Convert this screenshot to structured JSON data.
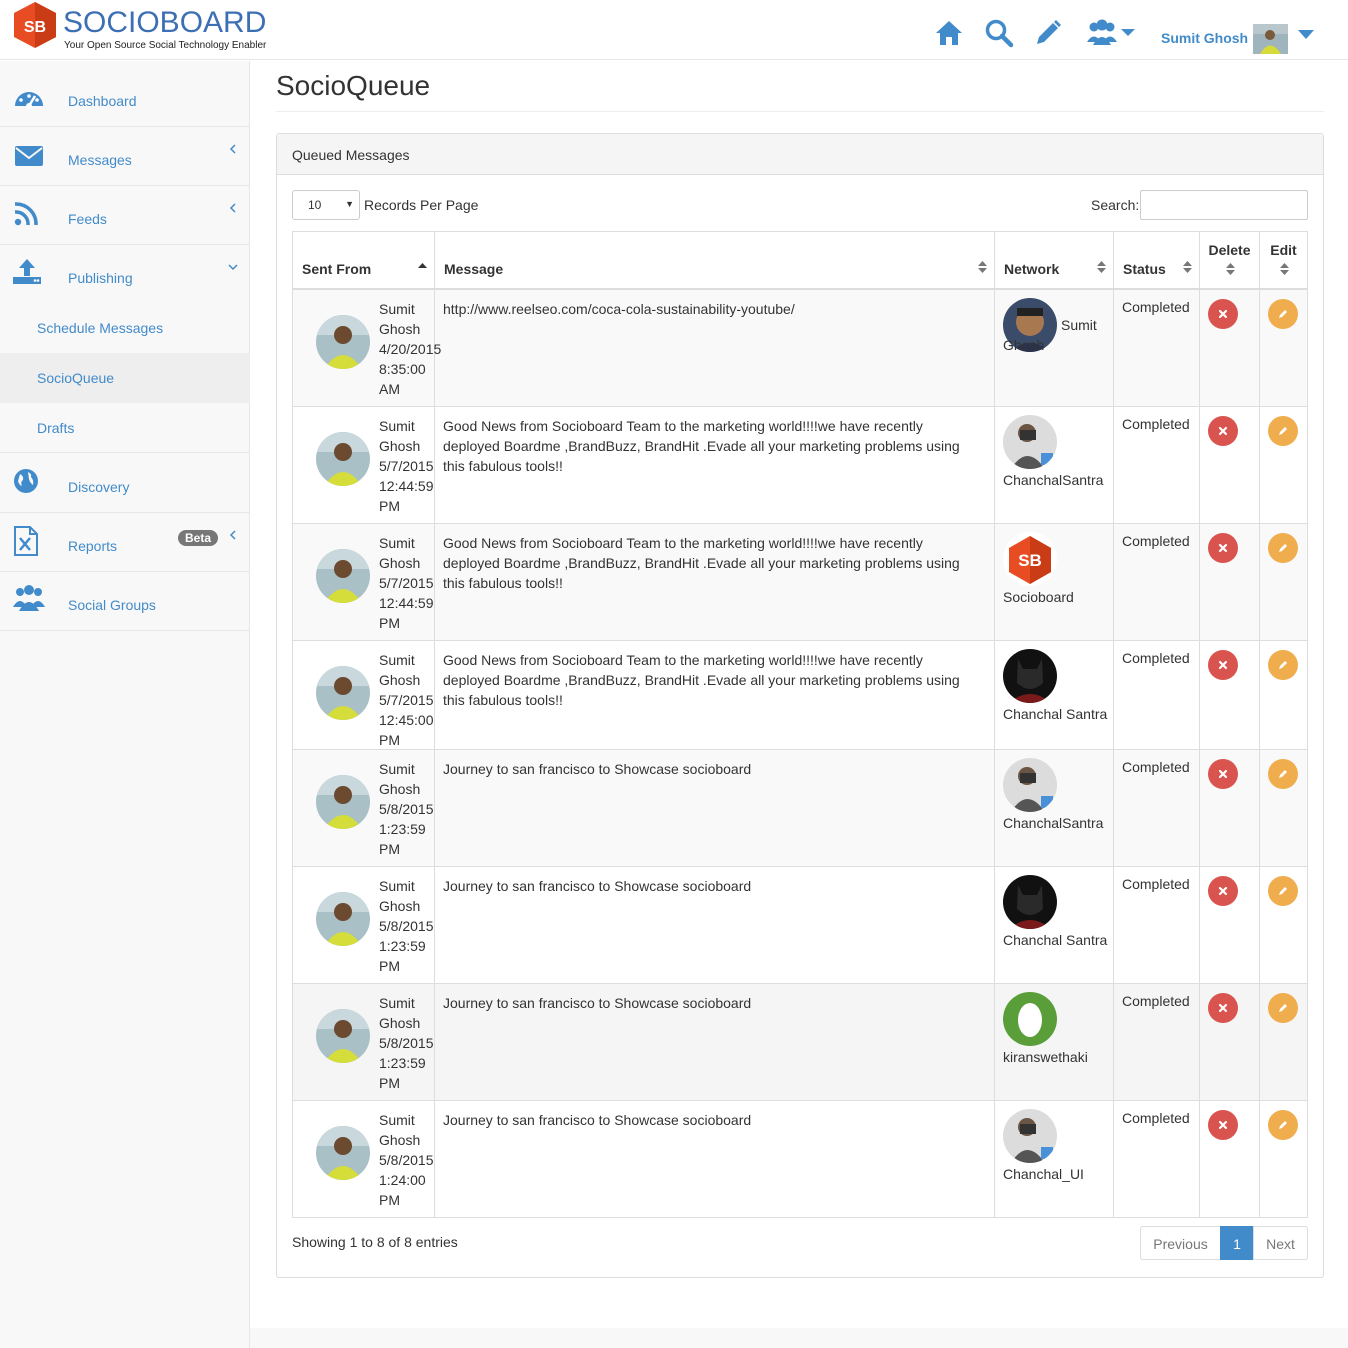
{
  "brand": {
    "badge": "SB",
    "name": "SOCIOBOARD",
    "tagline": "Your Open Source Social Technology Enabler",
    "color": "#3d6fb4",
    "badge_color": "#e84c22"
  },
  "header": {
    "icons": [
      "home-icon",
      "search-icon",
      "pencil-icon",
      "users-icon"
    ],
    "user_name": "Sumit Ghosh"
  },
  "sidebar": {
    "items": [
      {
        "label": "Dashboard",
        "icon": "dashboard-icon"
      },
      {
        "label": "Messages",
        "icon": "envelope-icon",
        "expandable": true
      },
      {
        "label": "Feeds",
        "icon": "rss-icon",
        "expandable": true
      },
      {
        "label": "Publishing",
        "icon": "upload-icon",
        "expanded": true
      },
      {
        "label": "Discovery",
        "icon": "globe-icon"
      },
      {
        "label": "Reports",
        "icon": "excel-file-icon",
        "badge": "Beta",
        "expandable": true
      },
      {
        "label": "Social Groups",
        "icon": "users-icon"
      }
    ],
    "publishing_sub": [
      {
        "label": "Schedule Messages"
      },
      {
        "label": "SocioQueue",
        "active": true
      },
      {
        "label": "Drafts"
      }
    ]
  },
  "page": {
    "title": "SocioQueue",
    "panel_title": "Queued Messages",
    "records_per_page": "10",
    "records_per_page_label": "Records Per Page",
    "search_label": "Search:",
    "search_value": ""
  },
  "table": {
    "headers": {
      "sent_from": "Sent From",
      "message": "Message",
      "network": "Network",
      "status": "Status",
      "delete": "Delete",
      "edit": "Edit"
    },
    "rows": [
      {
        "sender": "Sumit Ghosh",
        "date": "4/20/2015",
        "time": "8:35:00",
        "ampm": "AM",
        "message": "http://www.reelseo.com/coca-cola-sustainability-youtube/",
        "network": "Sumit Ghosh",
        "network_avatar": "person-photo",
        "status": "Completed"
      },
      {
        "sender": "Sumit Ghosh",
        "date": "5/7/2015",
        "time": "12:44:59",
        "ampm": "PM",
        "message": "Good News from Socioboard Team to the marketing world!!!!we have recently deployed Boardme ,BrandBuzz, BrandHit .Evade all your marketing problems using this fabulous tools!!",
        "network": "ChanchalSantra",
        "network_avatar": "camera-person-photo",
        "status": "Completed"
      },
      {
        "sender": "Sumit Ghosh",
        "date": "5/7/2015",
        "time": "12:44:59",
        "ampm": "PM",
        "message": "Good News from Socioboard Team to the marketing world!!!!we have recently deployed Boardme ,BrandBuzz, BrandHit .Evade all your marketing problems using this fabulous tools!!",
        "network": "Socioboard",
        "network_avatar": "socioboard-logo",
        "status": "Completed"
      },
      {
        "sender": "Sumit Ghosh",
        "date": "5/7/2015",
        "time": "12:45:00",
        "ampm": "PM",
        "message": "Good News from Socioboard Team to the marketing world!!!!we have recently deployed Boardme ,BrandBuzz, BrandHit .Evade all your marketing problems using this fabulous tools!!",
        "network": "Chanchal Santra",
        "network_avatar": "dark-mask-photo",
        "status": "Completed"
      },
      {
        "sender": "Sumit Ghosh",
        "date": "5/8/2015",
        "time": "1:23:59",
        "ampm": "PM",
        "message": "Journey to san francisco to Showcase socioboard",
        "network": "ChanchalSantra",
        "network_avatar": "camera-person-photo",
        "status": "Completed"
      },
      {
        "sender": "Sumit Ghosh",
        "date": "5/8/2015",
        "time": "1:23:59",
        "ampm": "PM",
        "message": "Journey to san francisco to Showcase socioboard",
        "network": "Chanchal Santra",
        "network_avatar": "dark-mask-photo",
        "status": "Completed"
      },
      {
        "sender": "Sumit Ghosh",
        "date": "5/8/2015",
        "time": "1:23:59",
        "ampm": "PM",
        "message": "Journey to san francisco to Showcase socioboard",
        "network": "kiranswethaki",
        "network_avatar": "green-egg-avatar",
        "status": "Completed"
      },
      {
        "sender": "Sumit Ghosh",
        "date": "5/8/2015",
        "time": "1:24:00",
        "ampm": "PM",
        "message": "Journey to san francisco to Showcase socioboard",
        "network": "Chanchal_UI",
        "network_avatar": "camera-person-photo",
        "status": "Completed"
      }
    ]
  },
  "footer": {
    "info": "Showing 1 to 8 of 8 entries",
    "previous": "Previous",
    "current_page": "1",
    "next": "Next"
  },
  "colors": {
    "primary": "#428bca",
    "delete": "#d9534f",
    "edit": "#f0ad4e"
  }
}
